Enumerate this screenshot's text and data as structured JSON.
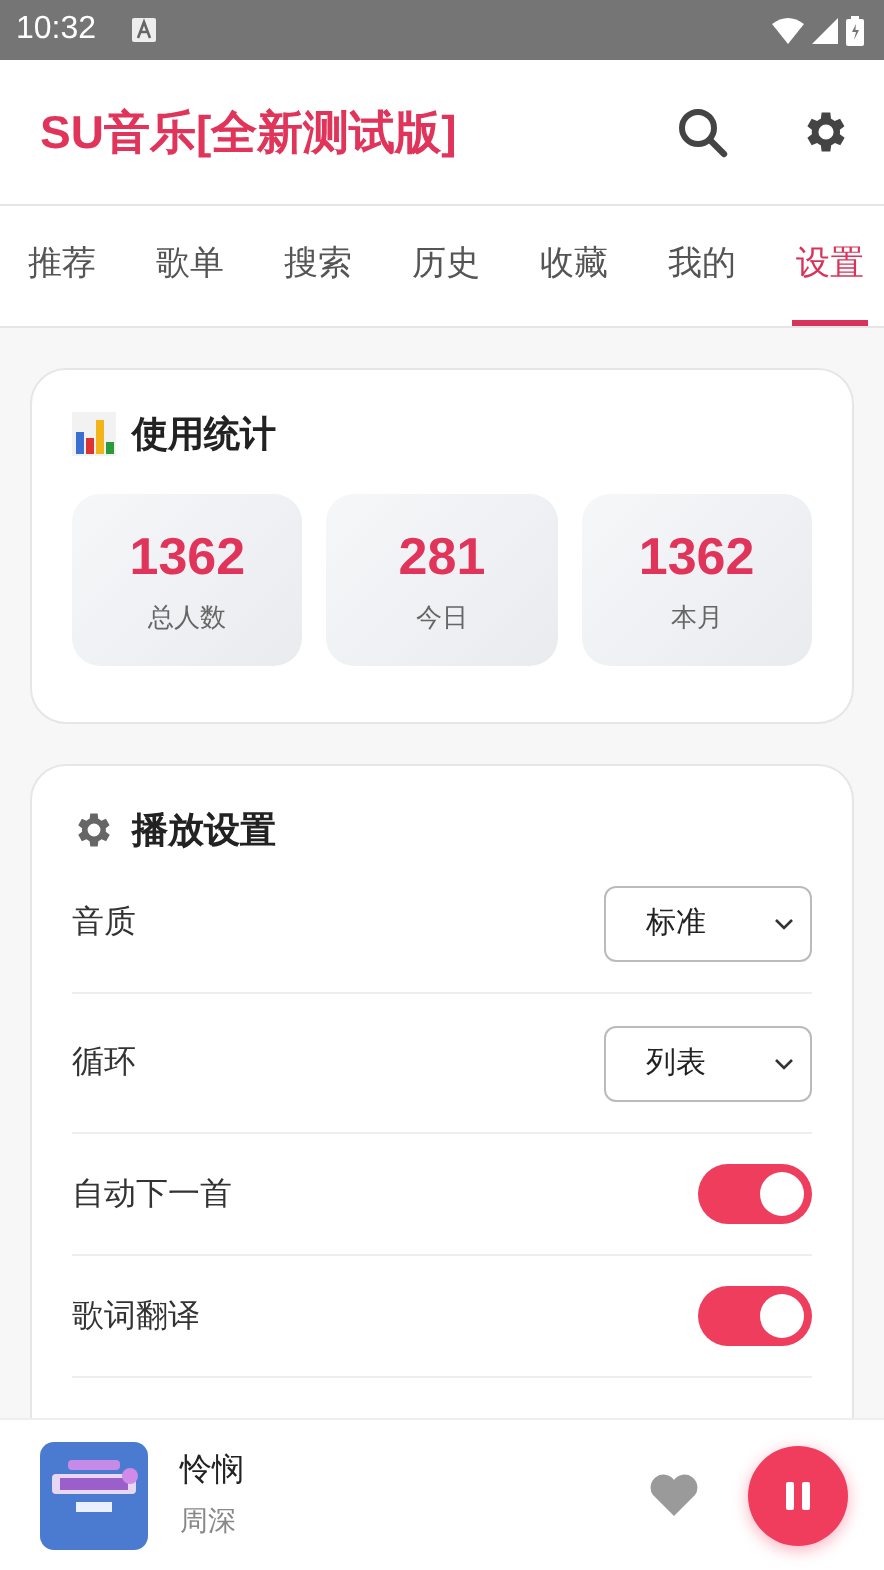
{
  "status_bar": {
    "time": "10:32"
  },
  "header": {
    "title": "SU音乐[全新测试版]"
  },
  "tabs": [
    {
      "label": "推荐",
      "selected": false
    },
    {
      "label": "歌单",
      "selected": false
    },
    {
      "label": "搜索",
      "selected": false
    },
    {
      "label": "历史",
      "selected": false
    },
    {
      "label": "收藏",
      "selected": false
    },
    {
      "label": "我的",
      "selected": false
    },
    {
      "label": "设置",
      "selected": true
    }
  ],
  "stats_card": {
    "title": "使用统计",
    "stats": [
      {
        "value": "1362",
        "label": "总人数"
      },
      {
        "value": "281",
        "label": "今日"
      },
      {
        "value": "1362",
        "label": "本月"
      }
    ]
  },
  "playback_card": {
    "title": "播放设置",
    "rows": [
      {
        "kind": "select",
        "label": "音质",
        "value": "标准"
      },
      {
        "kind": "select",
        "label": "循环",
        "value": "列表"
      },
      {
        "kind": "toggle",
        "label": "自动下一首",
        "on": true
      },
      {
        "kind": "toggle",
        "label": "歌词翻译",
        "on": true
      }
    ]
  },
  "player": {
    "song": "怜悯",
    "artist": "周深",
    "playing": true
  }
}
